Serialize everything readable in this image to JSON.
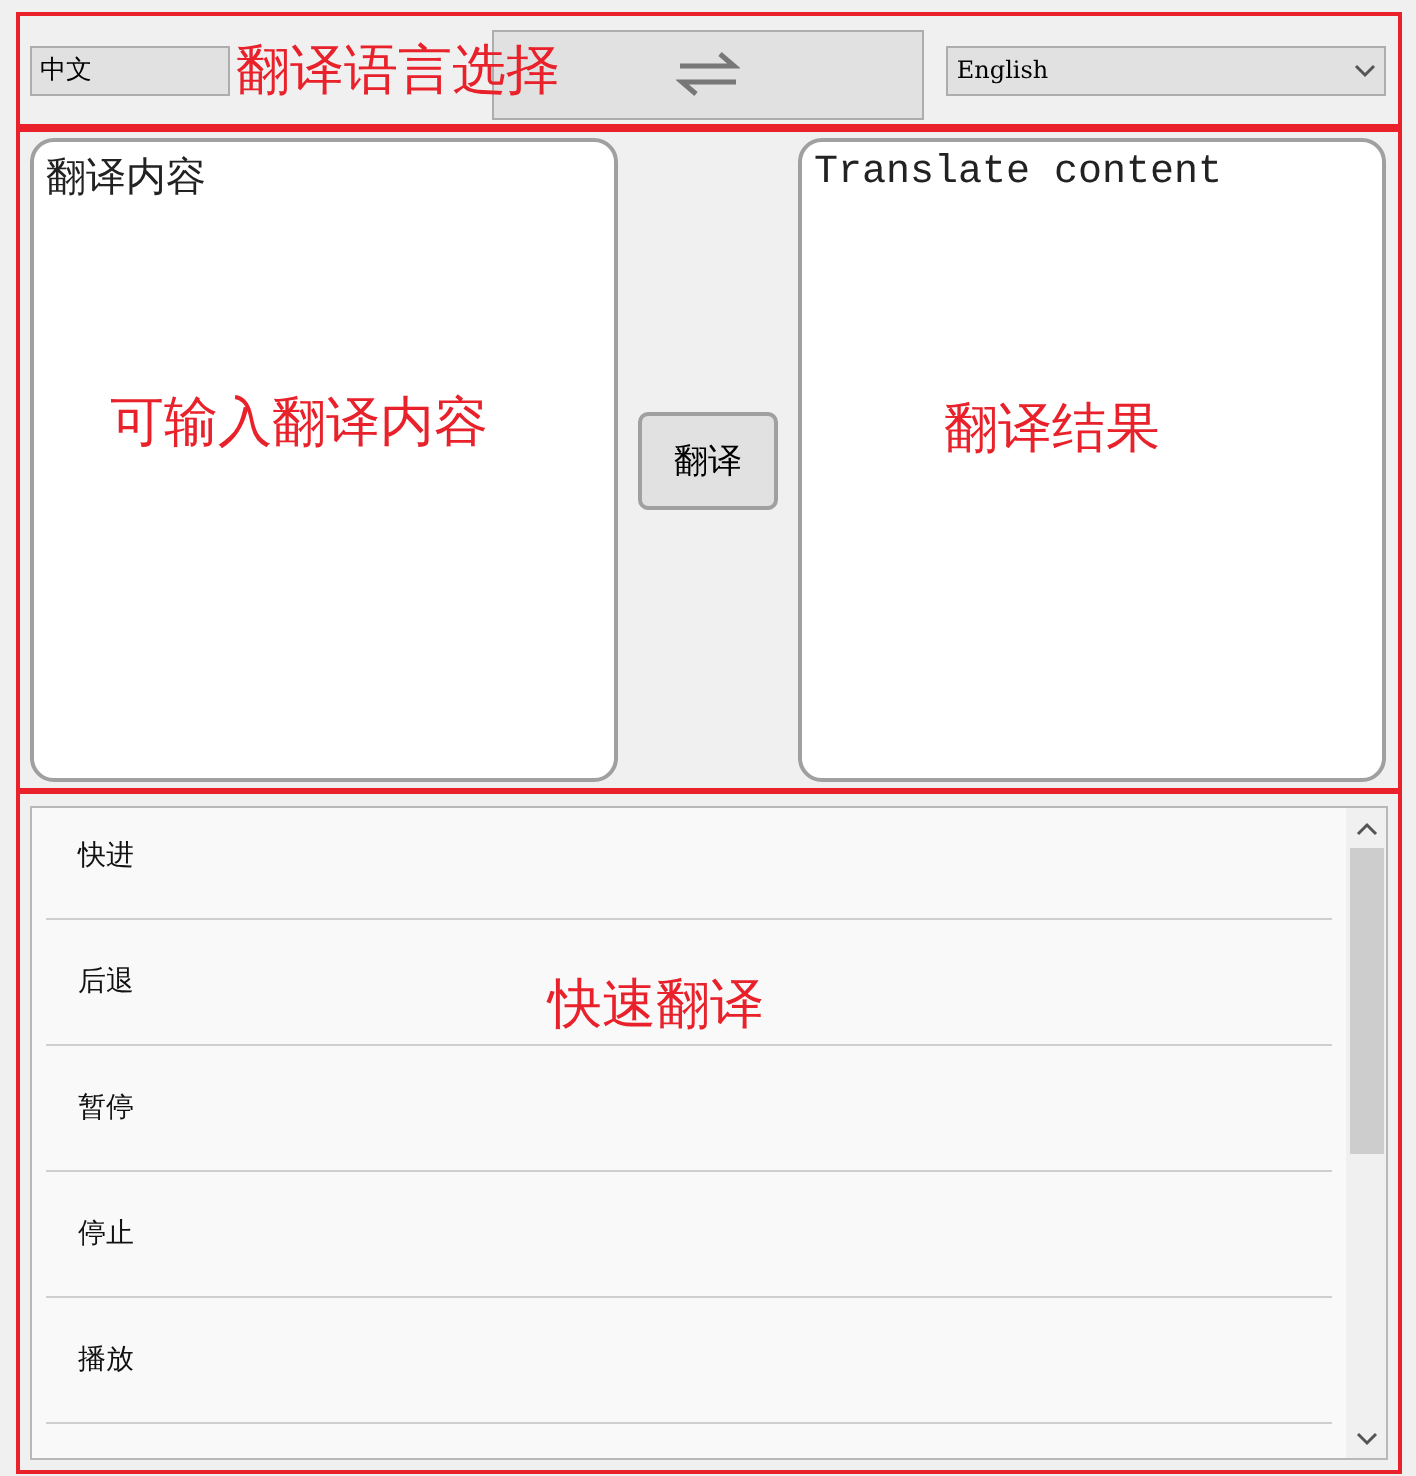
{
  "language_bar": {
    "source_language": "中文",
    "target_language": "English"
  },
  "translation": {
    "input": {
      "value": "翻译内容"
    },
    "translate_button": "翻译",
    "output": {
      "value": "Translate content"
    }
  },
  "quick_translate": {
    "items": [
      {
        "label": "快进"
      },
      {
        "label": "后退"
      },
      {
        "label": "暂停"
      },
      {
        "label": "停止"
      },
      {
        "label": "播放"
      }
    ]
  },
  "annotations": [
    {
      "text": "翻译语言选择"
    },
    {
      "text": "可输入翻译内容"
    },
    {
      "text": "翻译结果"
    },
    {
      "text": "快速翻译"
    }
  ]
}
